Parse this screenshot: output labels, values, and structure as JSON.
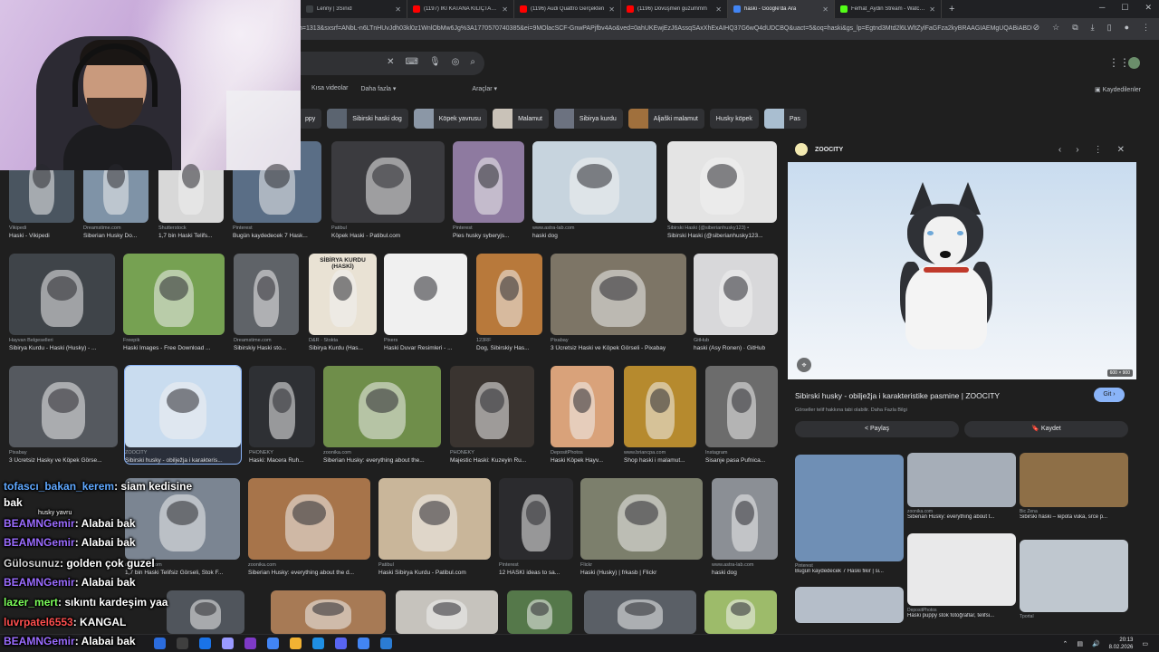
{
  "browser": {
    "tabs": [
      {
        "label": "Lenny | 3Sınıd",
        "color": "#3c4043",
        "active": false
      },
      {
        "label": "(1197) İKİ KATANA KILIÇTAN D",
        "color": "#ff0000",
        "active": false
      },
      {
        "label": "(1196) Audi Quattro Gerçekten",
        "color": "#ff0000",
        "active": false
      },
      {
        "label": "(1196) Dövüşmen guzummm",
        "color": "#ff0000",
        "active": false
      },
      {
        "label": "haski - Google'da Ara",
        "color": "#4285f4",
        "active": true
      },
      {
        "label": "Ferhat_Aydin Stream - Watch L",
        "color": "#53fc18",
        "active": false
      }
    ],
    "new_tab": "+",
    "url": "h=1313&sxsrf=ANbL-n6LTnHUvJdh03kl0z1WnlObMw6Jg%3A1770570740385&ei=9MOlacSCF-GnwPAPjfbv4Ao&ved=0ahUKEwjEzJ6AssqSAxXhExAIHQ37G6wQ4dUDCBQ&uact=5&oq=haski&gs_lp=Egtnd3Mtd2l6LWltZylFaGFza2kyBRAAGIAEMgUQABiABDIFE..."
  },
  "google": {
    "filters": [
      "Kısa videolar",
      "Daha fazla ▾",
      "Araçlar ▾"
    ],
    "saved": "Kaydedilenler",
    "chips": [
      {
        "label": "ppy",
        "thumb": false
      },
      {
        "label": "Sibirski haski dog",
        "thumb": true,
        "color": "#5b6470"
      },
      {
        "label": "Köpek yavrusu",
        "thumb": true,
        "color": "#8b97a6"
      },
      {
        "label": "Malamut",
        "thumb": true,
        "color": "#c9c2b8"
      },
      {
        "label": "Sibirya kurdu",
        "thumb": true,
        "color": "#6c7280"
      },
      {
        "label": "Aljaški malamut",
        "thumb": true,
        "color": "#a0703d"
      },
      {
        "label": "Husky köpek",
        "thumb": false
      },
      {
        "label": "Pas",
        "thumb": true,
        "color": "#a9bed0"
      }
    ]
  },
  "grid": [
    {
      "src": "Vikipedi",
      "title": "Haski - Vikipedi",
      "color": "#4a5560"
    },
    {
      "src": "Dreamstime.com",
      "title": "Siberian Husky Do...",
      "color": "#7f93a7"
    },
    {
      "src": "Shutterstock",
      "title": "1,7 bin Haski Telifs...",
      "color": "#d8d8d8"
    },
    {
      "src": "Pinterest",
      "title": "Bugün kaydedecek 7 Hask...",
      "color": "#5a6e86"
    },
    {
      "src": "Patibul",
      "title": "Köpek Haski - Patibul.com",
      "color": "#3b3b3f"
    },
    {
      "src": "Pinterest",
      "title": "Pies husky syberyjs...",
      "color": "#8e7aa0"
    },
    {
      "src": "www.astra-lab.com",
      "title": "haski dog",
      "color": "#c7d4de"
    },
    {
      "src": "Sibirski Haski (@siberianhusky123) •",
      "title": "Sibirski Haski (@siberianhusky123...",
      "color": "#e4e4e4"
    },
    {
      "src": "Hayvan Belgeselleri",
      "title": "Sibirya Kurdu - Haski (Husky) - ...",
      "color": "#3f4449"
    },
    {
      "src": "Freepik",
      "title": "Haski Images - Free Download ...",
      "color": "#76a152"
    },
    {
      "src": "Dreamstime.com",
      "title": "Sibirskiy Haski sto...",
      "color": "#5f6368"
    },
    {
      "src": "D&R · Stokta",
      "title": "Sibirya Kurdu (Has...",
      "color": "#e9e2d4",
      "book_title": "SİBİRYA KURDU (HASKİ)"
    },
    {
      "src": "Pixers",
      "title": "Haski Duvar Resimleri - ...",
      "color": "#f0f0f0"
    },
    {
      "src": "123RF",
      "title": "Dog, Sibirskiy Has...",
      "color": "#b8793b"
    },
    {
      "src": "Pixabay",
      "title": "3 Ücretsiz Haski ve Köpek Görseli - Pixabay",
      "color": "#7d7566"
    },
    {
      "src": "GitHub",
      "title": "haski (Asy Ronen) · GitHub",
      "color": "#d8d8da"
    },
    {
      "src": "Pixabay",
      "title": "3 Ücretsiz Hasky ve Köpek Görse...",
      "color": "#55595f"
    },
    {
      "src": "ZOOCITY",
      "title": "Sibirski husky - obilježja i karakteris...",
      "color": "#c9dcef"
    },
    {
      "src": "PHONEKY",
      "title": "Haski: Macera Ruh...",
      "color": "#2e3034"
    },
    {
      "src": "zoonika.com",
      "title": "Siberian Husky: everything about the...",
      "color": "#6f8e4a"
    },
    {
      "src": "PHONEKY",
      "title": "Majestic Haski: Kuzeyin Ru...",
      "color": "#3a3430"
    },
    {
      "src": "DepositPhotos",
      "title": "Haski Köpek Hayv...",
      "color": "#d9a27a"
    },
    {
      "src": "www.briancpa.com",
      "title": "Shop haski i malamut...",
      "color": "#b68a2e"
    },
    {
      "src": "Instagram",
      "title": "Sisanje pasa Pufnica...",
      "color": "#6c6c6c"
    },
    {
      "src": "dreamstime.com",
      "title": "1,7 bin Haski Telifsiz Görseli, Stok F...",
      "color": "#7b8592"
    },
    {
      "src": "zoonika.com",
      "title": "Siberian Husky: everything about the d...",
      "color": "#a7744a"
    },
    {
      "src": "Patibul",
      "title": "Haski Sibirya Kurdu - Patibul.com",
      "color": "#c9b69a"
    },
    {
      "src": "Pinterest",
      "title": "12 HASKI ideas to sa...",
      "color": "#2b2b2e"
    },
    {
      "src": "Flickr",
      "title": "Haski (Husky) | frkasb | Flickr",
      "color": "#7c7f6c"
    },
    {
      "src": "www.astra-lab.com",
      "title": "haski dog",
      "color": "#8b8f95"
    },
    {
      "src": "",
      "title": "",
      "color": "#50555c"
    },
    {
      "src": "",
      "title": "",
      "color": "#a77a55"
    },
    {
      "src": "",
      "title": "",
      "color": "#c6c3bd"
    },
    {
      "src": "",
      "title": "",
      "color": "#55784a"
    },
    {
      "src": "",
      "title": "",
      "color": "#5a5f66"
    },
    {
      "src": "",
      "title": "",
      "color": "#9dbb6a"
    }
  ],
  "panel": {
    "site": "ZOOCITY",
    "dims": "600 × 900",
    "title": "Sibirski husky - obilježja i karakteristike pasmine | ZOOCITY",
    "subtitle": "Görseller telif hakkına tabi olabilir. Daha Fazla Bilgi",
    "visit": "Git ›",
    "share": "< Paylaş",
    "save": "🔖 Kaydet",
    "related": [
      {
        "src": "Pinterest",
        "title": "Bugün kaydedecek 7 Haski fikir | si...",
        "color": "#6f8fb5"
      },
      {
        "src": "zoonika.com",
        "title": "Siberian Husky: everything about t...",
        "color": "#a6aeb8"
      },
      {
        "src": "Bic Žena",
        "title": "Sibirski haski – lepota vuka, srce p...",
        "color": "#8e6f47"
      },
      {
        "src": "DepositPhotos",
        "title": "Haski puppy stok fotoğraflar, telifsi...",
        "color": "#e9e9ea"
      },
      {
        "src": "Tportal",
        "title": "",
        "color": "#bfc7cf"
      },
      {
        "src": "",
        "title": "",
        "color": "#b5bec9"
      }
    ]
  },
  "chat": [
    {
      "user": "tofascı_bakan_kerem",
      "msg": ": siam kedisine",
      "user_color": "#5fa8ff"
    },
    {
      "user": "",
      "msg": "bak",
      "user_color": "#ffffff"
    },
    {
      "user": "",
      "msg": "husky yavru",
      "user_color": "#ffffff",
      "small": true
    },
    {
      "user": "BEAMNGemir",
      "msg": ": Alabai bak",
      "user_color": "#9b6cff"
    },
    {
      "user": "BEAMNGemir",
      "msg": ": Alabai bak",
      "user_color": "#9b6cff"
    },
    {
      "user": "Gülosunuz",
      "msg": ": golden çok guzel",
      "user_color": "#d2d2d2"
    },
    {
      "user": "BEAMNGemir",
      "msg": ": Alabai bak",
      "user_color": "#9b6cff"
    },
    {
      "user": "lazer_mert",
      "msg": ": sıkıntı kardeşim yaa",
      "user_color": "#7cff5a"
    },
    {
      "user": "luvrpatel6553",
      "msg": ": KANGAL",
      "user_color": "#ff4f4f"
    },
    {
      "user": "BEAMNGemir",
      "msg": ": Alabai bak",
      "user_color": "#9b6cff"
    }
  ],
  "taskbar": {
    "time": "20:13",
    "date": "8.02.2026",
    "icons": [
      "#2b6cdd",
      "#3f3f3f",
      "#1a73e8",
      "#9999ff",
      "#7e3ac7",
      "#4285f4",
      "#f2b233",
      "#1f8fe5",
      "#5865f2",
      "#4285f4",
      "#2b7cd3"
    ]
  }
}
